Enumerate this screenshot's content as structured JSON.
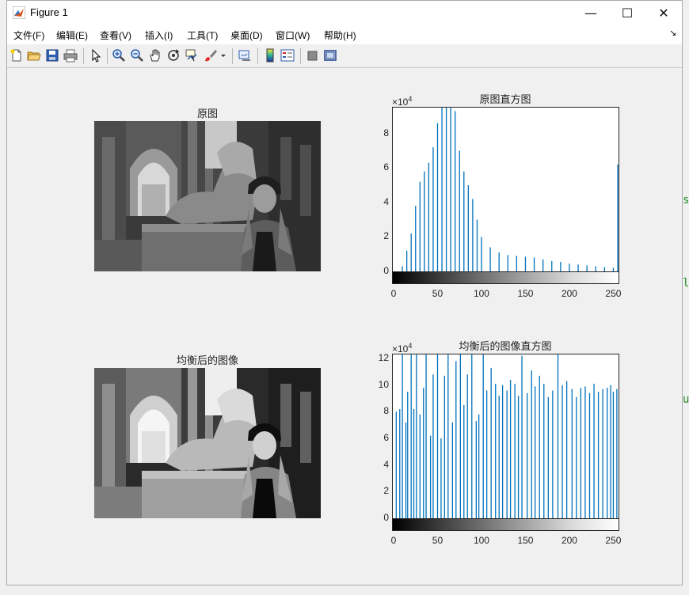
{
  "window": {
    "title": "Figure 1",
    "minimize": "—",
    "maximize": "☐",
    "close": "✕"
  },
  "menu": {
    "items": [
      "文件(F)",
      "编辑(E)",
      "查看(V)",
      "插入(I)",
      "工具(T)",
      "桌面(D)",
      "窗口(W)",
      "帮助(H)"
    ],
    "overflow": "↘"
  },
  "toolbar": {
    "icons": [
      "new-figure-icon",
      "open-file-icon",
      "save-icon",
      "print-icon",
      "pointer-icon",
      "zoom-in-icon",
      "zoom-out-icon",
      "pan-icon",
      "rotate-icon",
      "data-cursor-icon",
      "brush-icon",
      "brush-dropdown-icon",
      "link-plot-icon",
      "colorbar-icon",
      "legend-icon",
      "hide-plot-tools-icon",
      "show-plot-tools-icon"
    ]
  },
  "figure": {
    "panel1_title": "原图",
    "panel2_title": "原图直方图",
    "panel3_title": "均衡后的图像",
    "panel4_title": "均衡后的图像直方图",
    "hist1_exponent_base": "×10",
    "hist1_exponent_power": "4",
    "hist2_exponent_base": "×10",
    "hist2_exponent_power": "4"
  },
  "chart_data": [
    {
      "type": "bar",
      "title": "原图直方图",
      "xlabel": "",
      "ylabel": "",
      "xlim": [
        0,
        255
      ],
      "ylim": [
        0,
        95000
      ],
      "xticks": [
        0,
        50,
        100,
        150,
        200,
        250
      ],
      "yticks": [
        0,
        20000,
        40000,
        60000,
        80000
      ],
      "ytick_labels": [
        "0",
        "2",
        "4",
        "6",
        "8"
      ],
      "y_multiplier": "×10^4",
      "color": "#0072bd",
      "x": [
        0,
        10,
        15,
        20,
        25,
        30,
        35,
        40,
        45,
        50,
        55,
        60,
        65,
        70,
        75,
        80,
        85,
        90,
        95,
        100,
        110,
        120,
        130,
        140,
        150,
        160,
        170,
        180,
        190,
        200,
        210,
        220,
        230,
        240,
        250,
        255
      ],
      "values": [
        0,
        3000,
        12000,
        22000,
        38000,
        52000,
        58000,
        63000,
        72000,
        86000,
        95000,
        95000,
        95000,
        93000,
        70000,
        58000,
        50000,
        42000,
        30000,
        20000,
        14000,
        11000,
        9500,
        9000,
        8500,
        8000,
        7000,
        6000,
        5500,
        4500,
        4000,
        3500,
        3000,
        2500,
        2000,
        62000
      ]
    },
    {
      "type": "bar",
      "title": "均衡后的图像直方图",
      "xlabel": "",
      "ylabel": "",
      "xlim": [
        0,
        255
      ],
      "ylim": [
        0,
        123000
      ],
      "xticks": [
        0,
        50,
        100,
        150,
        200,
        250
      ],
      "yticks": [
        0,
        20000,
        40000,
        60000,
        80000,
        100000,
        120000
      ],
      "ytick_labels": [
        "0",
        "2",
        "4",
        "6",
        "8",
        "10",
        "12"
      ],
      "y_multiplier": "×10^4",
      "color": "#0072bd",
      "x": [
        3,
        7,
        10,
        14,
        16,
        20,
        23,
        26,
        30,
        34,
        37,
        42,
        45,
        50,
        54,
        58,
        62,
        67,
        71,
        76,
        80,
        84,
        89,
        94,
        97,
        102,
        106,
        111,
        116,
        120,
        124,
        129,
        133,
        138,
        142,
        146,
        152,
        157,
        161,
        166,
        171,
        176,
        181,
        187,
        192,
        197,
        203,
        208,
        213,
        218,
        223,
        228,
        233,
        238,
        243,
        247,
        250,
        254
      ],
      "values": [
        80000,
        82000,
        123000,
        72000,
        95000,
        123000,
        82000,
        123000,
        78000,
        98000,
        123000,
        62000,
        108000,
        123000,
        60000,
        107000,
        123000,
        72000,
        118000,
        123000,
        85000,
        108000,
        123000,
        73000,
        78000,
        123000,
        96000,
        113000,
        101000,
        92000,
        100000,
        96000,
        104000,
        101000,
        92000,
        122000,
        94000,
        111000,
        99000,
        107000,
        101000,
        91000,
        96000,
        123000,
        100000,
        103000,
        97000,
        91000,
        98000,
        99000,
        94000,
        101000,
        95000,
        97000,
        98000,
        100000,
        95000,
        97000
      ]
    }
  ]
}
